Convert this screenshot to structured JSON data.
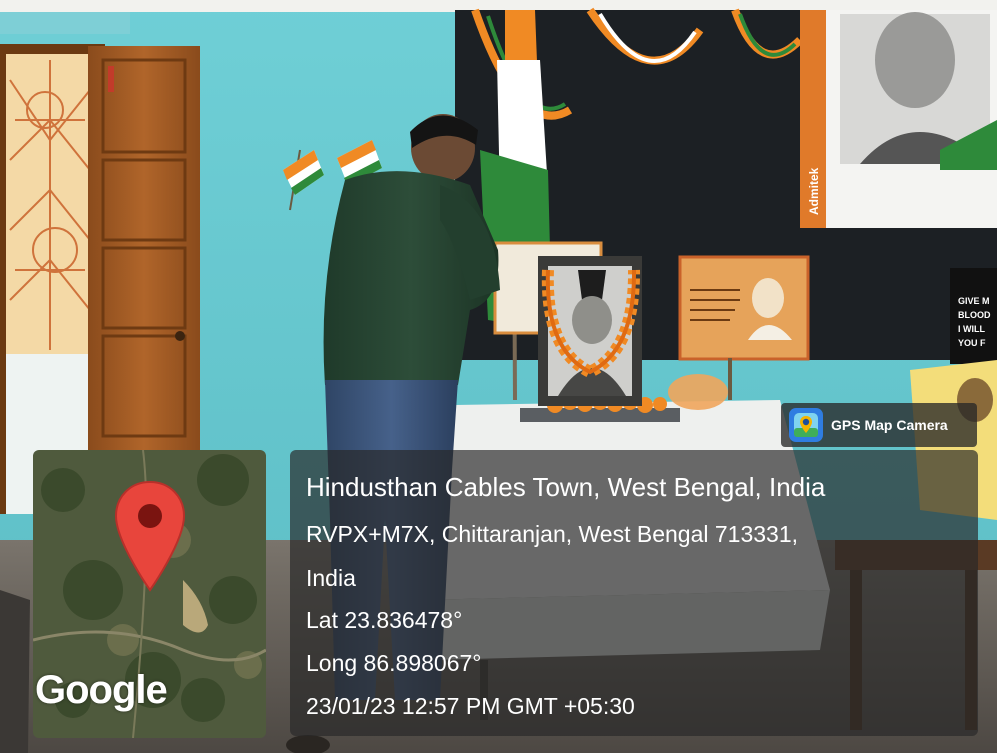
{
  "photo": {
    "poster_quote": "GIVE ME BLOOD I WILL GIVE YOU F",
    "frame_brand": "Admitek"
  },
  "app_badge": {
    "label": "GPS Map Camera",
    "icon": "gps-camera-app-icon"
  },
  "map": {
    "provider_logo": "Google",
    "marker_icon": "map-pin-icon"
  },
  "location": {
    "title": "Hindusthan Cables Town, West Bengal, India",
    "address_line1": "RVPX+M7X, Chittaranjan, West Bengal 713331,",
    "address_line2": "India",
    "lat": "Lat 23.836478°",
    "long": "Long 86.898067°",
    "datetime": "23/01/23 12:57 PM GMT +05:30"
  }
}
